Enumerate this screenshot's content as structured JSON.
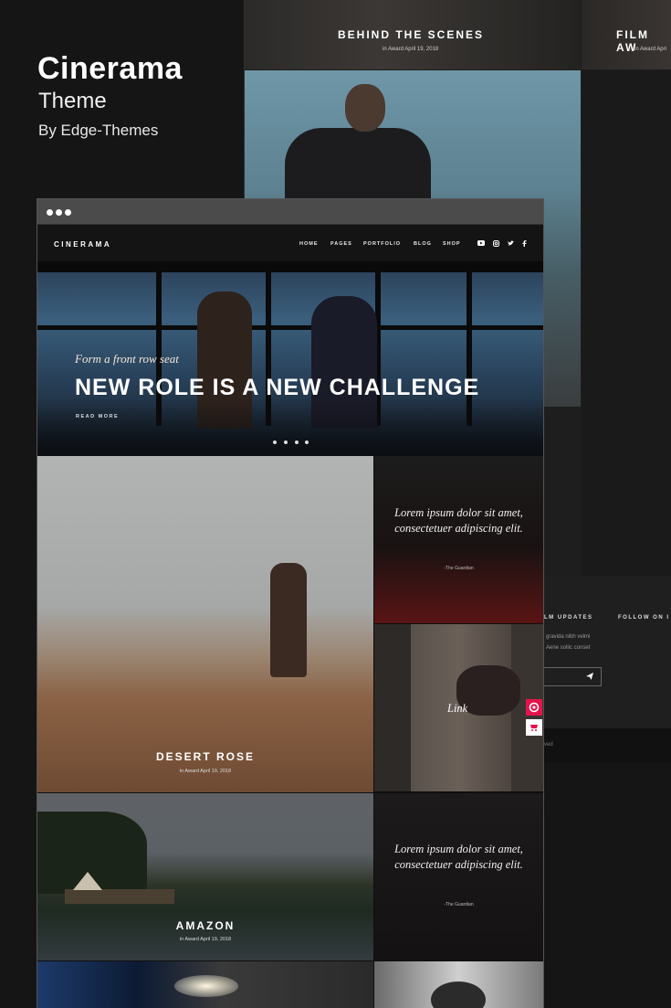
{
  "brand": {
    "title": "Cinerama",
    "subtitle": "Theme",
    "author": "By Edge-Themes"
  },
  "background_preview": {
    "tile1_title": "BEHIND THE SCENES",
    "tile1_meta": "in Award   April 19, 2018",
    "tile2_title": "FILM AW",
    "tile2_meta": "in Award   Apri",
    "footer_col1_title": "LM UPDATES",
    "footer_col2_title": "FOLLOW ON I",
    "footer_text1": "gravida nibh velmi",
    "footer_text2": "Aene sollic conset",
    "footer_small": "ved"
  },
  "site": {
    "logo": "CINERAMA",
    "nav": [
      "HOME",
      "PAGES",
      "PORTFOLIO",
      "BLOG",
      "SHOP"
    ],
    "social_icons": [
      "youtube-icon",
      "instagram-icon",
      "twitter-icon",
      "facebook-icon"
    ],
    "hero": {
      "eyebrow": "Form a front row seat",
      "title": "NEW ROLE IS A NEW CHALLENGE",
      "cta": "READ MORE",
      "slides": 4
    },
    "tiles": {
      "desert_title": "DESERT ROSE",
      "desert_meta": "in Award   April 19, 2018",
      "quote1_text": "Lorem ipsum dolor sit amet, consectetuer adipiscing elit.",
      "quote1_source": "-The Guardian",
      "link_label": "Link",
      "amazon_title": "AMAZON",
      "amazon_meta": "in Award   April 19, 2018",
      "quote2_text": "Lorem ipsum dolor sit amet, consectetuer adipiscing elit.",
      "quote2_source": "-The Guardian"
    }
  },
  "colors": {
    "accent_pink": "#e3144c",
    "background": "#151515",
    "chrome": "#4b4b4b"
  }
}
